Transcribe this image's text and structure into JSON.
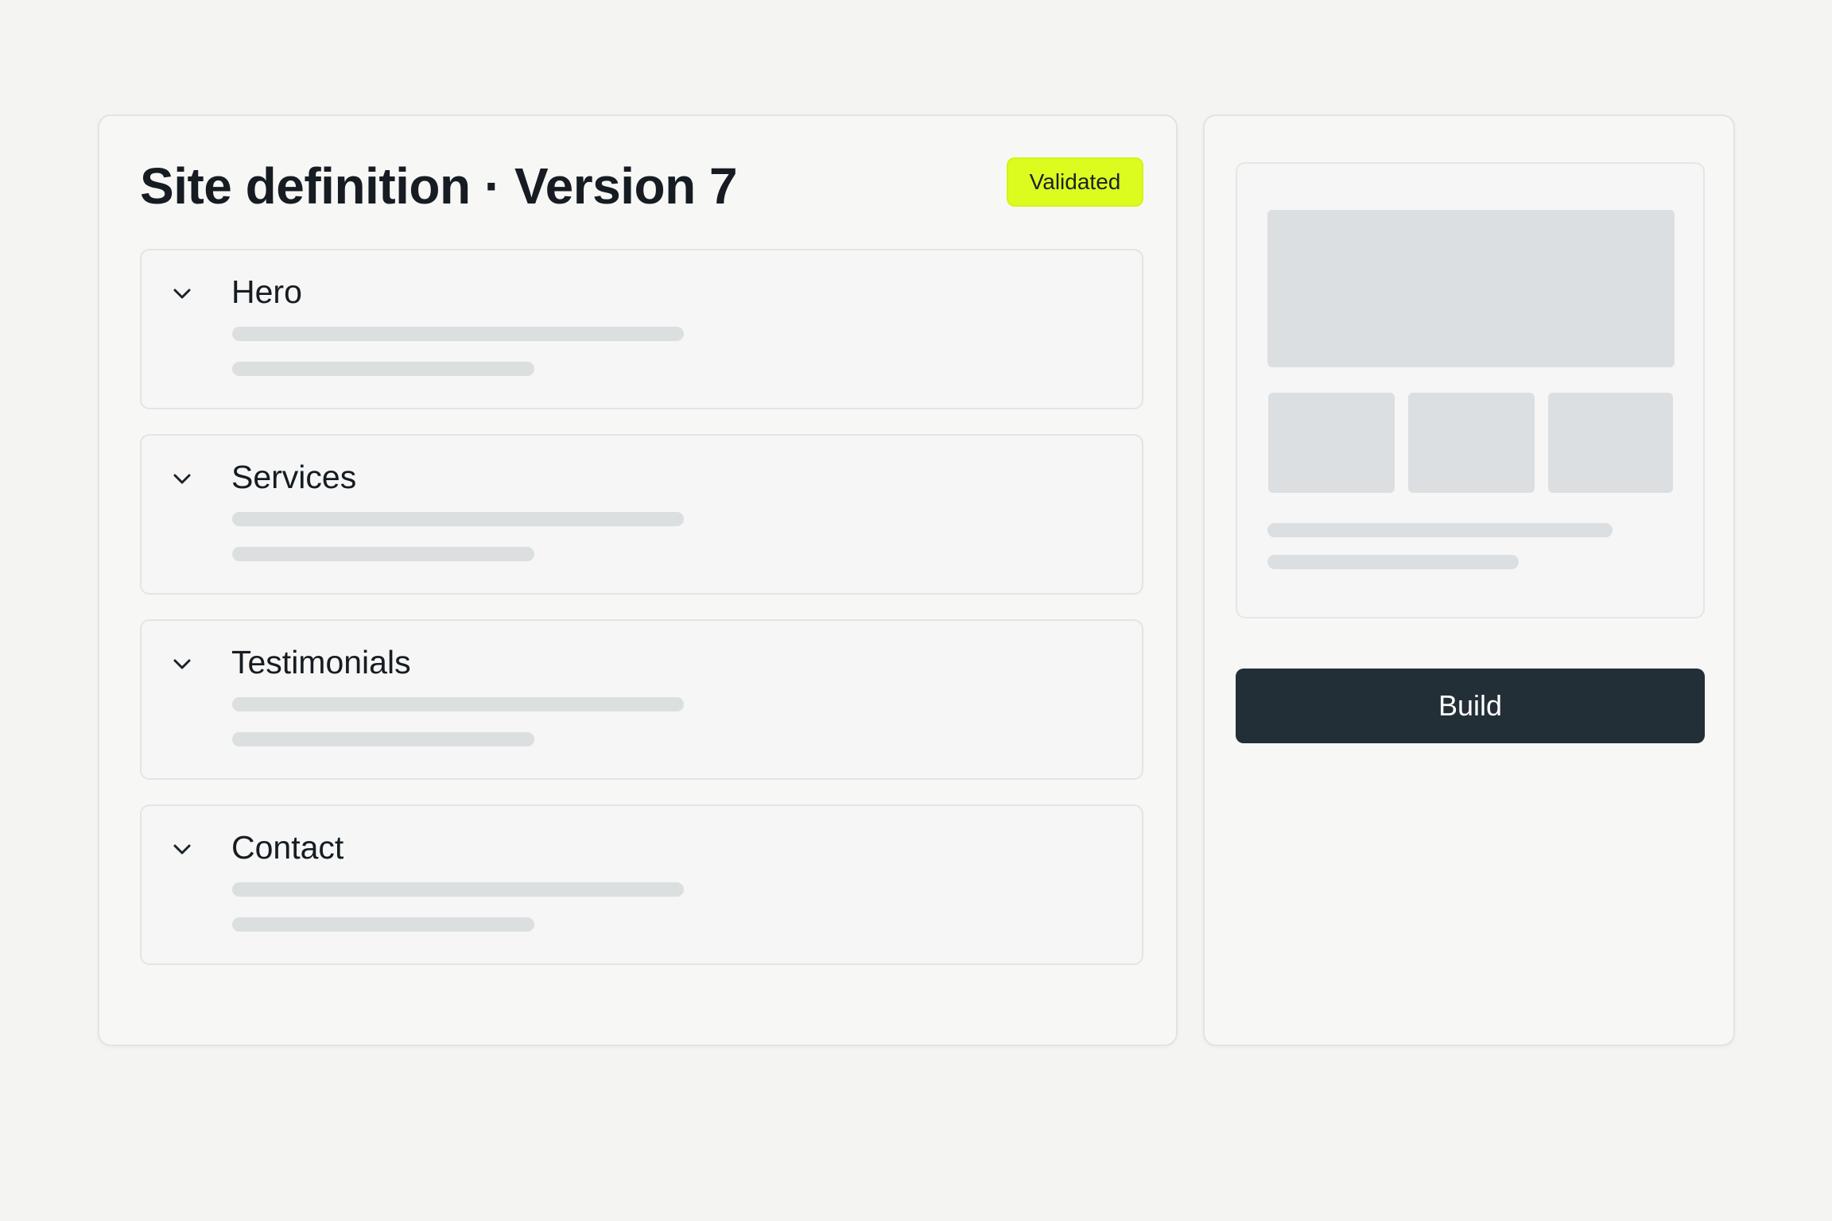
{
  "header": {
    "title": "Site definition · Version 7",
    "status_badge": "Validated"
  },
  "sections": [
    {
      "title": "Hero",
      "expand_icon": "chevron-down-icon"
    },
    {
      "title": "Services",
      "expand_icon": "chevron-down-icon"
    },
    {
      "title": "Testimonials",
      "expand_icon": "chevron-down-icon"
    },
    {
      "title": "Contact",
      "expand_icon": "chevron-down-icon"
    }
  ],
  "actions": {
    "build_label": "Build"
  },
  "colors": {
    "badge_background": "#dcfb1f",
    "build_button_background": "#232f37",
    "skeleton": "#dcdfe0",
    "page_background": "#f4f4f2"
  }
}
